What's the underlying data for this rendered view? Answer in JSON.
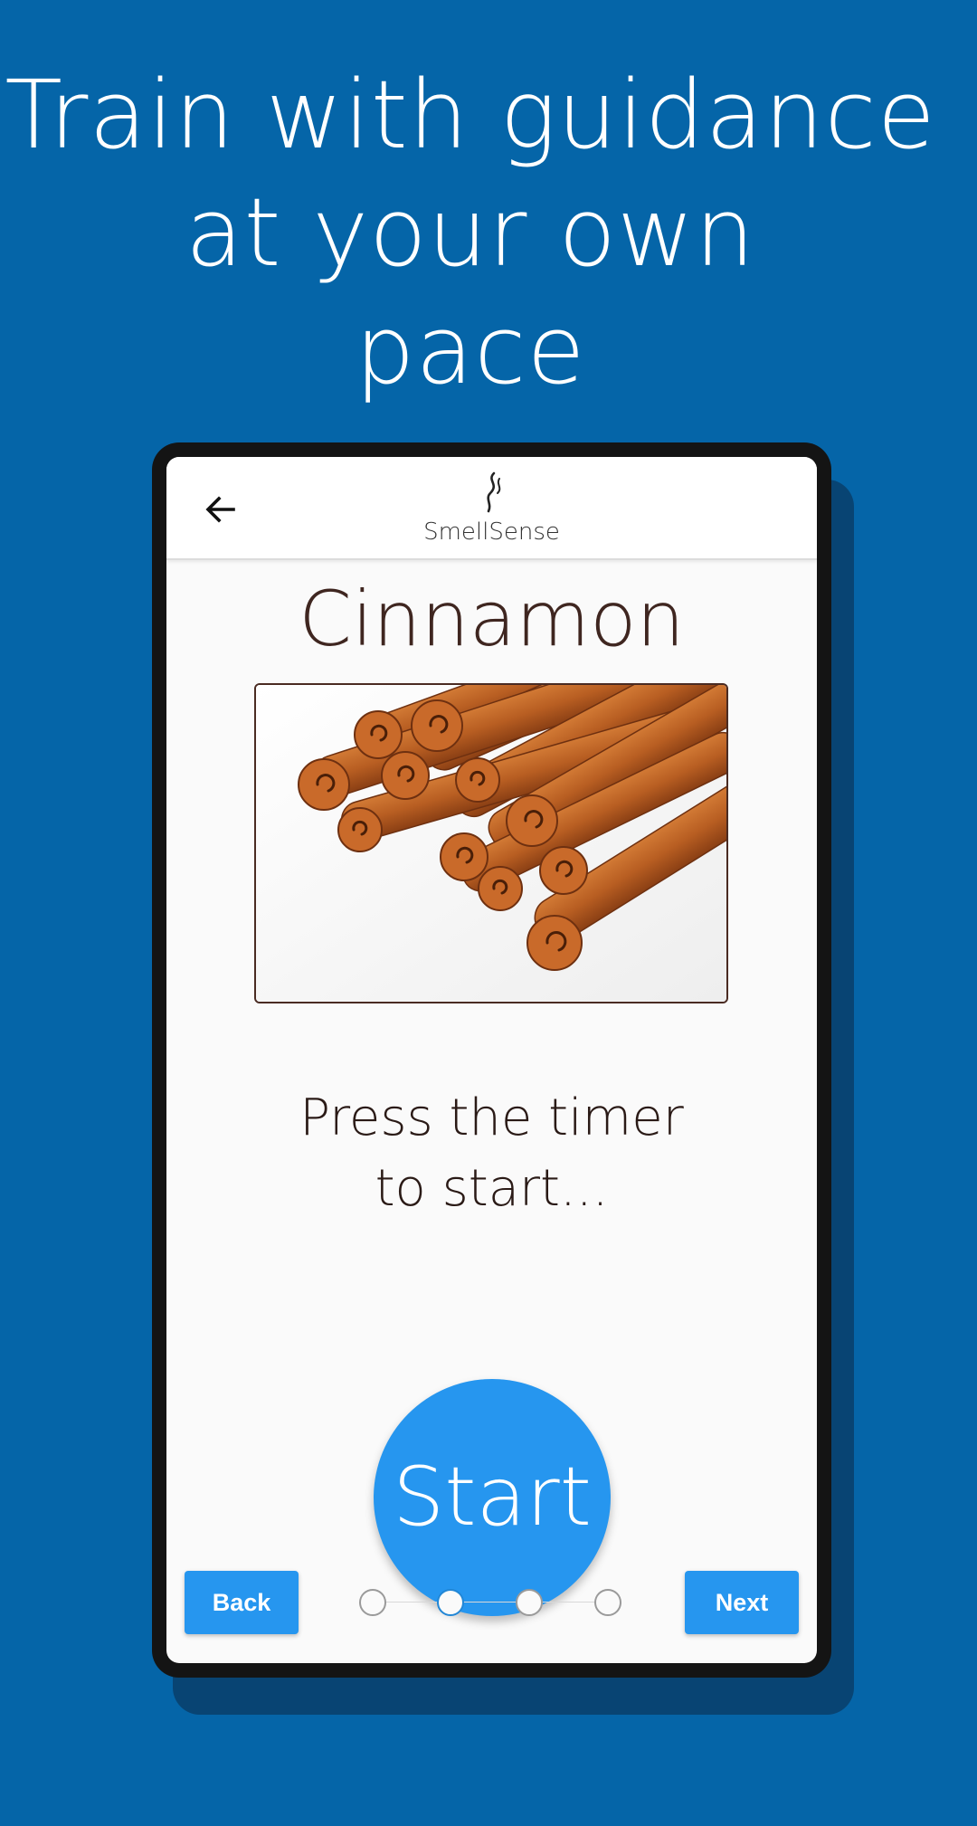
{
  "headline": {
    "line1": "Train with guidance",
    "line2": "at your own",
    "line3": "pace"
  },
  "app": {
    "brand": "SmellSense",
    "icons": {
      "back": "arrow-left-icon",
      "logo": "scent-wisp-icon"
    }
  },
  "scent": {
    "title": "Cinnamon",
    "image": "cinnamon sticks photo"
  },
  "instruction": {
    "line1": "Press the timer",
    "line2": "to start..."
  },
  "timer": {
    "start_label": "Start"
  },
  "navigation": {
    "back_label": "Back",
    "next_label": "Next",
    "steps_total": 4,
    "current_step": 2
  },
  "colors": {
    "background": "#0565a8",
    "accent": "#2696ef",
    "title_brown": "#3f2620",
    "device": "#141414"
  }
}
